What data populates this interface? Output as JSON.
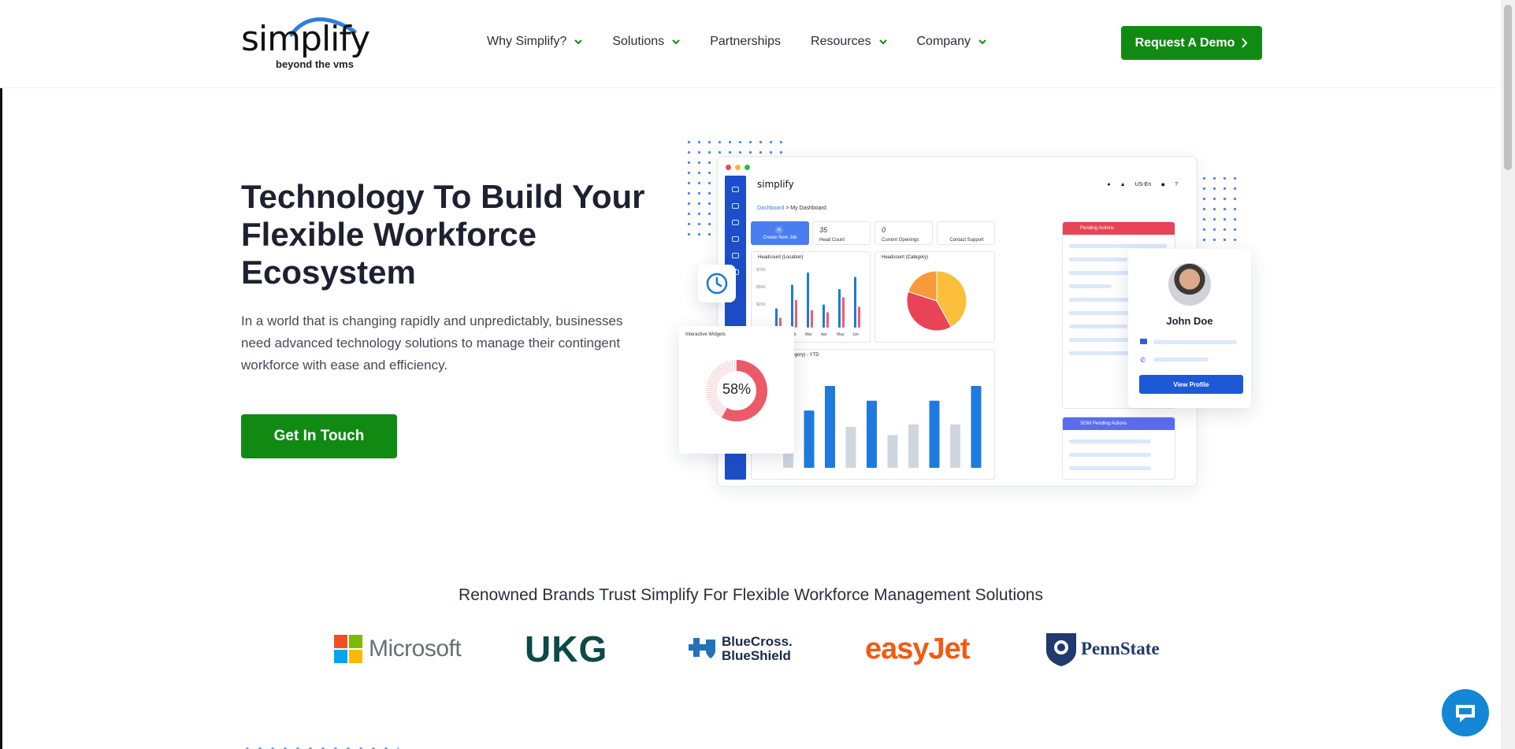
{
  "header": {
    "logo_text": "simplify",
    "logo_tagline": "beyond the vms",
    "nav": [
      {
        "label": "Why Simplify?",
        "has_dropdown": true
      },
      {
        "label": "Solutions",
        "has_dropdown": true
      },
      {
        "label": "Partnerships",
        "has_dropdown": false
      },
      {
        "label": "Resources",
        "has_dropdown": true
      },
      {
        "label": "Company",
        "has_dropdown": true
      }
    ],
    "demo_button": "Request A Demo"
  },
  "hero": {
    "title": "Technology To Build Your Flexible Workforce Ecosystem",
    "description": "In a world that is changing rapidly and unpredictably, businesses need advanced technology solutions to manage their contingent workforce with ease and efficiency.",
    "cta_button": "Get In Touch"
  },
  "dashboard": {
    "logo": "simplify",
    "breadcrumb_root": "Dashboard",
    "breadcrumb_current": "My Dashboard",
    "top_right": "US-En",
    "cards": {
      "create_job": "Create New Job",
      "head_count_value": "35",
      "head_count_label": "Head Count",
      "openings_value": "0",
      "openings_label": "Current Openings",
      "support_label": "Contact Support"
    },
    "headcount_location": {
      "title": "Headcount (Location)",
      "y_ticks": [
        "$75K",
        "$50K",
        "$25K"
      ],
      "months": [
        "Jan",
        "Feb",
        "Mar",
        "Apr",
        "May",
        "Jun"
      ],
      "blue": [
        0.35,
        0.78,
        1.0,
        0.42,
        0.7,
        0.92
      ],
      "red": [
        0.18,
        0.5,
        0.32,
        0.28,
        0.55,
        0.38
      ]
    },
    "headcount_category": {
      "title": "Headcount (Category)",
      "slices": [
        {
          "value": 0.42,
          "color": "#fbbf3c"
        },
        {
          "value": 0.38,
          "color": "#e84357"
        },
        {
          "value": 0.2,
          "color": "#f79a3a"
        }
      ]
    },
    "ytd": {
      "title": "(Category) - YTD",
      "bars": [
        {
          "value": 0.35,
          "color": "#cfd6e0"
        },
        {
          "value": 0.7,
          "color": "#1f7ae0"
        },
        {
          "value": 1.0,
          "color": "#1f7ae0"
        },
        {
          "value": 0.5,
          "color": "#cfd6e0"
        },
        {
          "value": 0.82,
          "color": "#1f7ae0"
        },
        {
          "value": 0.4,
          "color": "#cfd6e0"
        },
        {
          "value": 0.53,
          "color": "#cfd6e0"
        },
        {
          "value": 0.82,
          "color": "#1f7ae0"
        },
        {
          "value": 0.53,
          "color": "#cfd6e0"
        },
        {
          "value": 1.0,
          "color": "#1f7ae0"
        }
      ]
    },
    "pending_actions": "Pending Actions",
    "sow_pending_actions": "SOW Pending Actions",
    "widget_label": "Interactive Widgets",
    "widget_percent": "58%",
    "widget_fraction": 0.58,
    "profile_name": "John Doe",
    "profile_button": "View Profile"
  },
  "trust": {
    "title": "Renowned Brands Trust Simplify For Flexible Workforce Management Solutions",
    "brands": {
      "microsoft": "Microsoft",
      "ukg": "UKG",
      "bluecross_1": "BlueCross.",
      "bluecross_2": "BlueShield",
      "easyjet": "easyJet",
      "pennstate": "PennState"
    }
  },
  "colors": {
    "primary_green": "#118a14",
    "accent_blue": "#1d58d6",
    "dot_blue": "#4a86f0"
  }
}
